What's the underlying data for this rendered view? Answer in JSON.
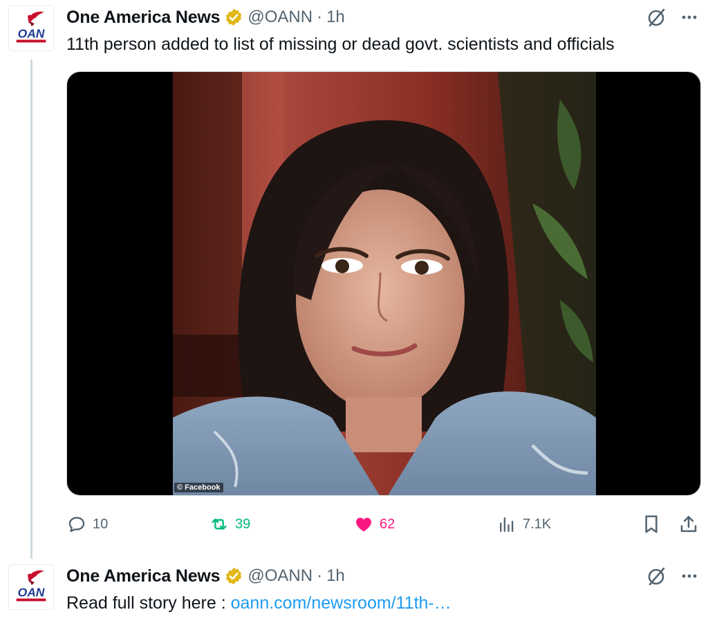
{
  "tweets": [
    {
      "author_name": "One America News",
      "handle": "@OANN",
      "separator": "·",
      "time": "1h",
      "avatar_text": "OAN",
      "text": "11th person added to list of missing or dead govt. scientists and officials",
      "media_credit": "© Facebook",
      "stats": {
        "replies": "10",
        "reposts": "39",
        "likes": "62",
        "views": "7.1K"
      }
    },
    {
      "author_name": "One America News",
      "handle": "@OANN",
      "separator": "·",
      "time": "1h",
      "avatar_text": "OAN",
      "text_prefix": "Read full story here : ",
      "link_text": "oann.com/newsroom/11th-…"
    }
  ],
  "icons": {
    "verified": "verified-badge-icon",
    "grok": "grok-icon",
    "more": "more-icon",
    "reply": "reply-icon",
    "repost": "repost-icon",
    "like": "heart-icon",
    "views": "views-icon",
    "bookmark": "bookmark-icon",
    "share": "share-icon"
  },
  "colors": {
    "text_primary": "#0f1419",
    "text_secondary": "#536471",
    "link": "#1d9bf0",
    "repost_active": "#00ba7c",
    "like_active": "#f91880",
    "verified_gold": "#e2b719",
    "oan_red": "#c8102e",
    "oan_blue": "#1f3a93"
  }
}
